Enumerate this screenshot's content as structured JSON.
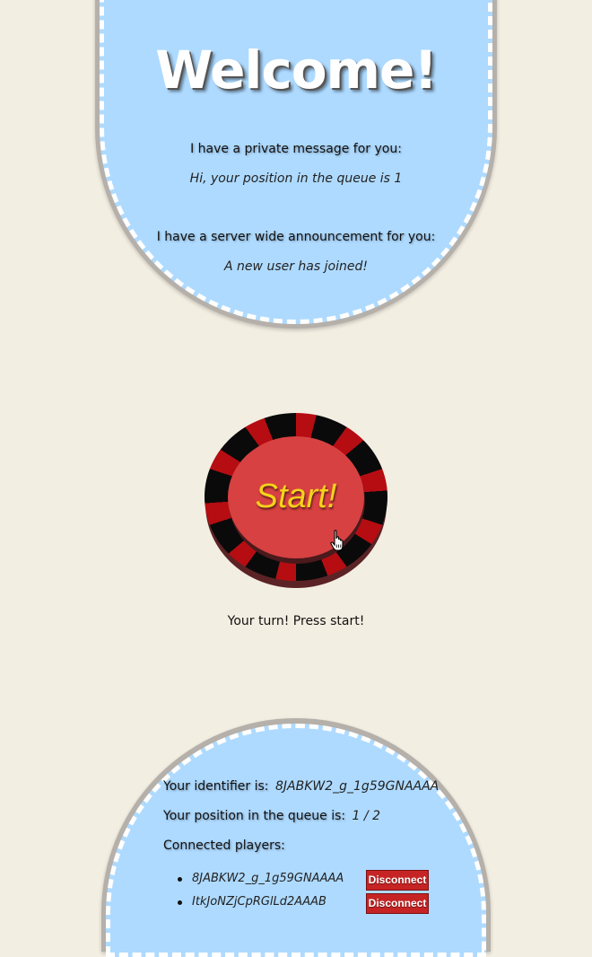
{
  "welcome": {
    "title": "Welcome!",
    "private_heading": "I have a private message for you:",
    "private_message": "Hi, your position in the queue is 1",
    "announcement_heading": "I have a server wide announcement for you:",
    "announcement_message": "A new user has joined!"
  },
  "start": {
    "label": "Start!",
    "status_text": "Your turn! Press start!"
  },
  "info": {
    "identifier_label": "Your identifier is:",
    "identifier_value": "8JABKW2_g_1g59GNAAAA",
    "position_label": "Your position in the queue is:",
    "position_value": "1 / 2",
    "players_label": "Connected players:",
    "players": [
      {
        "id": "8JABKW2_g_1g59GNAAAA",
        "action": "Disconnect"
      },
      {
        "id": "ItkJoNZjCpRGlLd2AAAB",
        "action": "Disconnect"
      }
    ]
  },
  "colors": {
    "background": "#f3eee2",
    "panel": "#aedaff",
    "chip_red": "#d84141",
    "start_text": "#f5d21c",
    "disconnect": "#c62424"
  },
  "icons": {
    "cursor": "hand-pointer-icon"
  }
}
